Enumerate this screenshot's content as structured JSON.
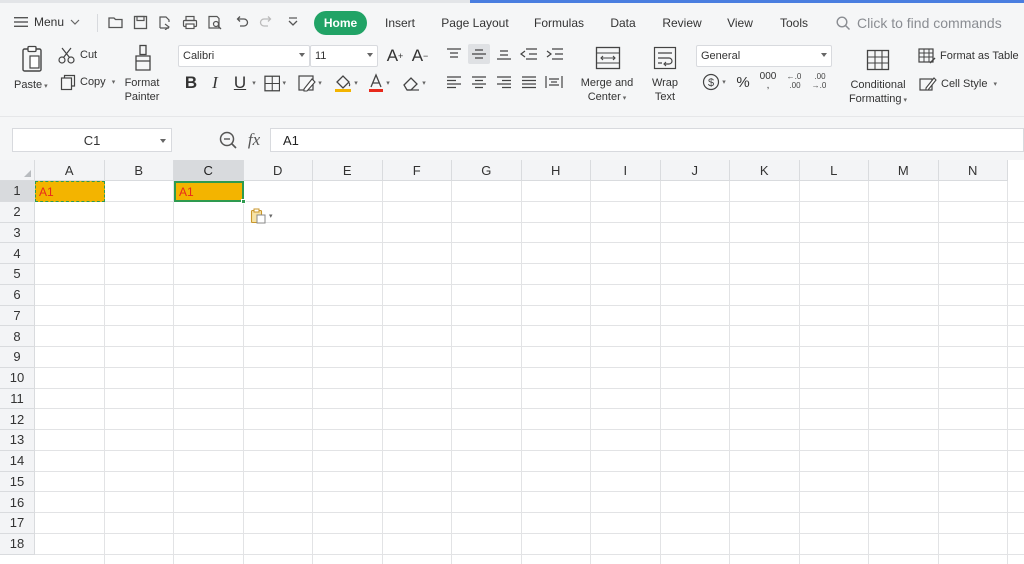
{
  "titlebar": {
    "menu_label": "Menu",
    "tabs": [
      {
        "label": "Home",
        "active": true
      },
      {
        "label": "Insert"
      },
      {
        "label": "Page Layout"
      },
      {
        "label": "Formulas"
      },
      {
        "label": "Data"
      },
      {
        "label": "Review"
      },
      {
        "label": "View"
      },
      {
        "label": "Tools"
      }
    ],
    "search_placeholder": "Click to find commands"
  },
  "ribbon": {
    "paste": "Paste",
    "cut": "Cut",
    "copy": "Copy",
    "format_painter_line1": "Format",
    "format_painter_line2": "Painter",
    "font_name": "Calibri",
    "font_size": "11",
    "bold": "B",
    "italic": "I",
    "underline": "U",
    "merge_line1": "Merge and",
    "merge_line2": "Center",
    "wrap_line1": "Wrap",
    "wrap_line2": "Text",
    "number_format": "General",
    "percent": "%",
    "thousands": "000",
    "conditional_line1": "Conditional",
    "conditional_line2": "Formatting",
    "format_as_table": "Format as Table",
    "cell_style": "Cell Style"
  },
  "formula_bar": {
    "name_box": "C1",
    "fx": "fx",
    "value": "A1"
  },
  "sheet": {
    "columns": [
      "A",
      "B",
      "C",
      "D",
      "E",
      "F",
      "G",
      "H",
      "I",
      "J",
      "K",
      "L",
      "M",
      "N"
    ],
    "rows": [
      "1",
      "2",
      "3",
      "4",
      "5",
      "6",
      "7",
      "8",
      "9",
      "10",
      "11",
      "12",
      "13",
      "14",
      "15",
      "16",
      "17",
      "18"
    ],
    "cells": {
      "A1": "A1",
      "C1": "A1"
    },
    "selected_column": "C",
    "selected_row": "1"
  },
  "colors": {
    "accent_green": "#21a366",
    "cell_fill": "#f3b400",
    "cell_text": "#e8291b",
    "selection_border": "#2e9a4f"
  }
}
